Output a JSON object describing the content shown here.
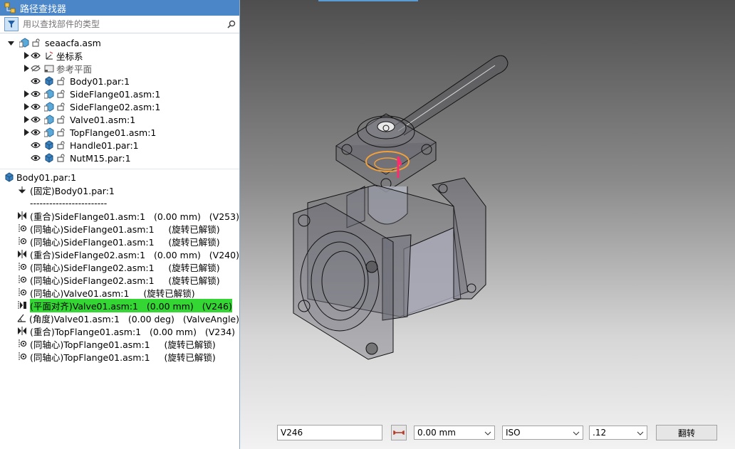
{
  "panel": {
    "title": "路径查找器",
    "search_placeholder": "用以查找部件的类型"
  },
  "tree": {
    "root": "seaacfa.asm",
    "items": [
      {
        "label": "坐标系",
        "type": "coord"
      },
      {
        "label": "参考平面",
        "type": "plane"
      },
      {
        "label": "Body01.par:1",
        "type": "part"
      },
      {
        "label": "SideFlange01.asm:1",
        "type": "asm"
      },
      {
        "label": "SideFlange02.asm:1",
        "type": "asm"
      },
      {
        "label": "Valve01.asm:1",
        "type": "asm"
      },
      {
        "label": "TopFlange01.asm:1",
        "type": "asm"
      },
      {
        "label": "Handle01.par:1",
        "type": "part"
      },
      {
        "label": "NutM15.par:1",
        "type": "part"
      }
    ]
  },
  "relations": {
    "header": "Body01.par:1",
    "fixed": "(固定)Body01.par:1",
    "divider": "------------------------",
    "items": [
      {
        "text": "(重合)SideFlange01.asm:1   (0.00 mm)   (V253)",
        "kind": "mate"
      },
      {
        "text": "(同轴心)SideFlange01.asm:1     (旋转已解锁)",
        "kind": "axial"
      },
      {
        "text": "(同轴心)SideFlange01.asm:1     (旋转已解锁)",
        "kind": "axial"
      },
      {
        "text": "(重合)SideFlange02.asm:1   (0.00 mm)   (V240)",
        "kind": "mate"
      },
      {
        "text": "(同轴心)SideFlange02.asm:1     (旋转已解锁)",
        "kind": "axial"
      },
      {
        "text": "(同轴心)SideFlange02.asm:1     (旋转已解锁)",
        "kind": "axial"
      },
      {
        "text": "(同轴心)Valve01.asm:1     (旋转已解锁)",
        "kind": "axial"
      },
      {
        "text": "(平面对齐)Valve01.asm:1   (0.00 mm)   (V246)",
        "kind": "planar"
      },
      {
        "text": "(角度)Valve01.asm:1   (0.00 deg)   (ValveAngle)",
        "kind": "angle"
      },
      {
        "text": "(重合)TopFlange01.asm:1   (0.00 mm)   (V234)",
        "kind": "mate"
      },
      {
        "text": "(同轴心)TopFlange01.asm:1     (旋转已解锁)",
        "kind": "axial"
      },
      {
        "text": "(同轴心)TopFlange01.asm:1     (旋转已解锁)",
        "kind": "axial"
      }
    ]
  },
  "cmdbar": {
    "name_value": "V246",
    "offset_value": "0.00 mm",
    "standard_value": "ISO",
    "precision_value": ".12",
    "flip_label": "翻转"
  }
}
